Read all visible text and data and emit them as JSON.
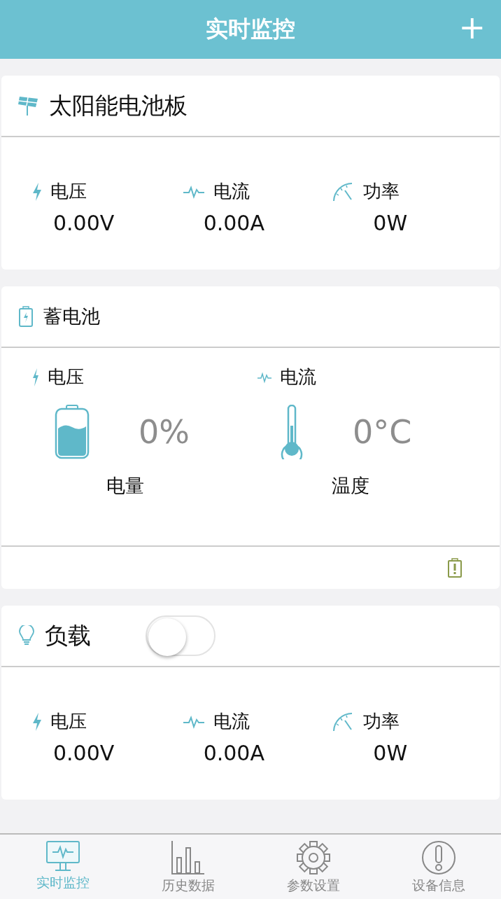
{
  "header": {
    "title": "实时监控",
    "add": "+"
  },
  "solar": {
    "title": "太阳能电池板",
    "metrics": [
      {
        "kind": "voltage",
        "label": "电压",
        "value": "0.00V"
      },
      {
        "kind": "current",
        "label": "电流",
        "value": "0.00A"
      },
      {
        "kind": "power",
        "label": "功率",
        "value": "0W"
      }
    ]
  },
  "battery": {
    "title": "蓄电池",
    "columns": [
      {
        "kind": "voltage",
        "label": "电压",
        "reading": "0%",
        "caption": "电量"
      },
      {
        "kind": "current",
        "label": "电流",
        "reading": "0°C",
        "caption": "温度"
      }
    ]
  },
  "load": {
    "title": "负载",
    "on": false,
    "metrics": [
      {
        "kind": "voltage",
        "label": "电压",
        "value": "0.00V"
      },
      {
        "kind": "current",
        "label": "电流",
        "value": "0.00A"
      },
      {
        "kind": "power",
        "label": "功率",
        "value": "0W"
      }
    ]
  },
  "tabs": [
    {
      "kind": "monitor",
      "label": "实时监控",
      "selected": true
    },
    {
      "kind": "history",
      "label": "历史数据",
      "selected": false
    },
    {
      "kind": "settings",
      "label": "参数设置",
      "selected": false
    },
    {
      "kind": "info",
      "label": "设备信息",
      "selected": false
    }
  ]
}
